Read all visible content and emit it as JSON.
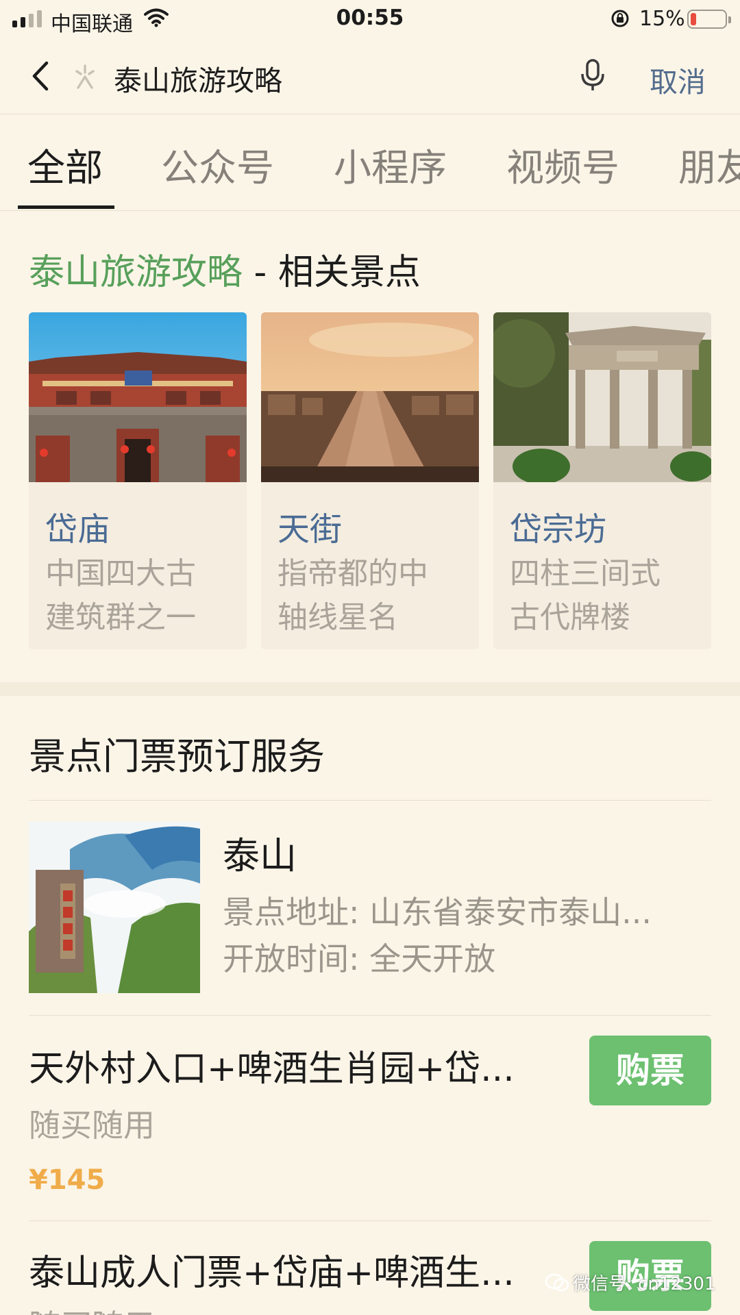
{
  "status_bar": {
    "carrier": "中国联通",
    "time": "00:55",
    "battery_percent_label": "15%",
    "battery_level": 0.15,
    "signal_bars_filled": 2,
    "signal_bars_total": 4
  },
  "search": {
    "query": "泰山旅游攻略",
    "cancel_label": "取消"
  },
  "tabs": [
    "全部",
    "公众号",
    "小程序",
    "视频号",
    "朋友"
  ],
  "related": {
    "title_highlight": "泰山旅游攻略",
    "title_rest": " - 相关景点",
    "cards": [
      {
        "name": "岱庙",
        "desc_line1": "中国四大古",
        "desc_line2": "建筑群之一"
      },
      {
        "name": "天街",
        "desc_line1": "指帝都的中",
        "desc_line2": "轴线星名"
      },
      {
        "name": "岱宗坊",
        "desc_line1": "四柱三间式",
        "desc_line2": "古代牌楼"
      }
    ]
  },
  "tickets": {
    "section_title": "景点门票预订服务",
    "spot": {
      "name": "泰山",
      "address": "景点地址: 山东省泰安市泰山...",
      "hours": "开放时间: 全天开放"
    },
    "items": [
      {
        "title": "天外村入口+啤酒生肖园+岱...",
        "sub": "随买随用",
        "price": "¥145",
        "button": "购票"
      },
      {
        "title": "泰山成人门票+岱庙+啤酒生...",
        "sub": "随买随用",
        "button": "购票"
      }
    ]
  },
  "watermark": "微信号: cn12301",
  "colors": {
    "background": "#fbf5e8",
    "highlight_green": "#58a05b",
    "buy_button": "#6cc070",
    "price_orange": "#f0ac4a",
    "link_blue": "#536c8c"
  }
}
